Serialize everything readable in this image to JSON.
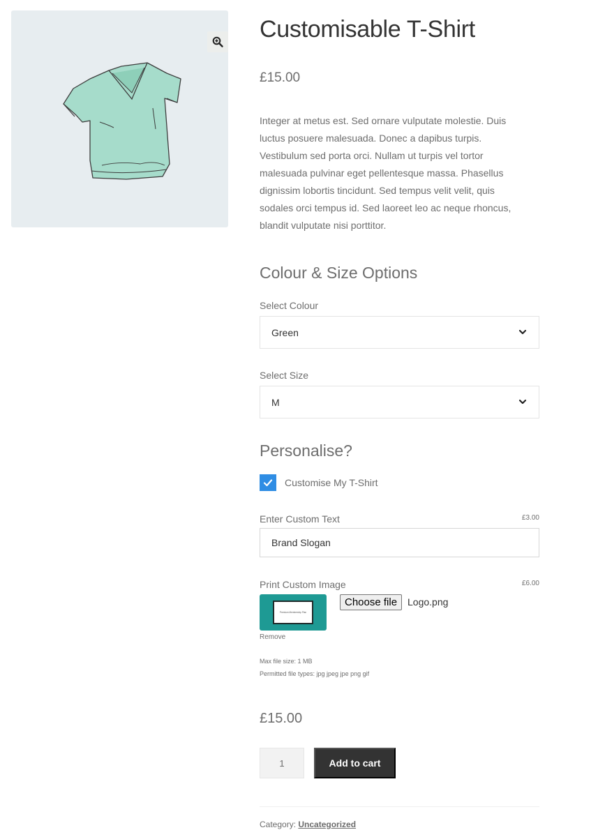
{
  "product": {
    "title": "Customisable T-Shirt",
    "price": "£15.00",
    "description": "Integer at metus est. Sed ornare vulputate molestie. Duis luctus posuere malesuada. Donec a dapibus turpis. Vestibulum sed porta orci. Nullam ut turpis vel tortor malesuada pulvinar eget pellentesque massa. Phasellus dignissim lobortis tincidunt. Sed tempus velit velit, quis sodales orci tempus id. Sed laoreet leo ac neque rhoncus, blandit vulputate nisi porttitor.",
    "image_icon": "tshirt-image",
    "zoom_icon": "zoom-in-icon"
  },
  "options": {
    "heading": "Colour & Size Options",
    "colour": {
      "label": "Select Colour",
      "value": "Green"
    },
    "size": {
      "label": "Select Size",
      "value": "M"
    }
  },
  "personalise": {
    "heading": "Personalise?",
    "checkbox": {
      "label": "Customise My T-Shirt",
      "checked": true
    },
    "custom_text": {
      "label": "Enter Custom Text",
      "price": "£3.00",
      "value": "Brand Slogan"
    },
    "custom_image": {
      "label": "Print Custom Image",
      "price": "£6.00",
      "thumbnail_text": "Premium Membership Plan",
      "choose_button": "Choose file",
      "file_name": "Logo.png",
      "remove_label": "Remove",
      "max_size": "Max file size: 1 MB",
      "permitted_types": "Permitted file types: jpg jpeg jpe png gif"
    }
  },
  "cart": {
    "total_price": "£15.00",
    "quantity": "1",
    "add_to_cart_label": "Add to cart"
  },
  "meta": {
    "category_label": "Category:",
    "category_value": "Uncategorized"
  },
  "colors": {
    "checkbox_accent": "#2f8de4",
    "button_bg": "#333333",
    "thumbnail_bg": "#1e9a94",
    "gallery_bg": "#e7edf0"
  }
}
